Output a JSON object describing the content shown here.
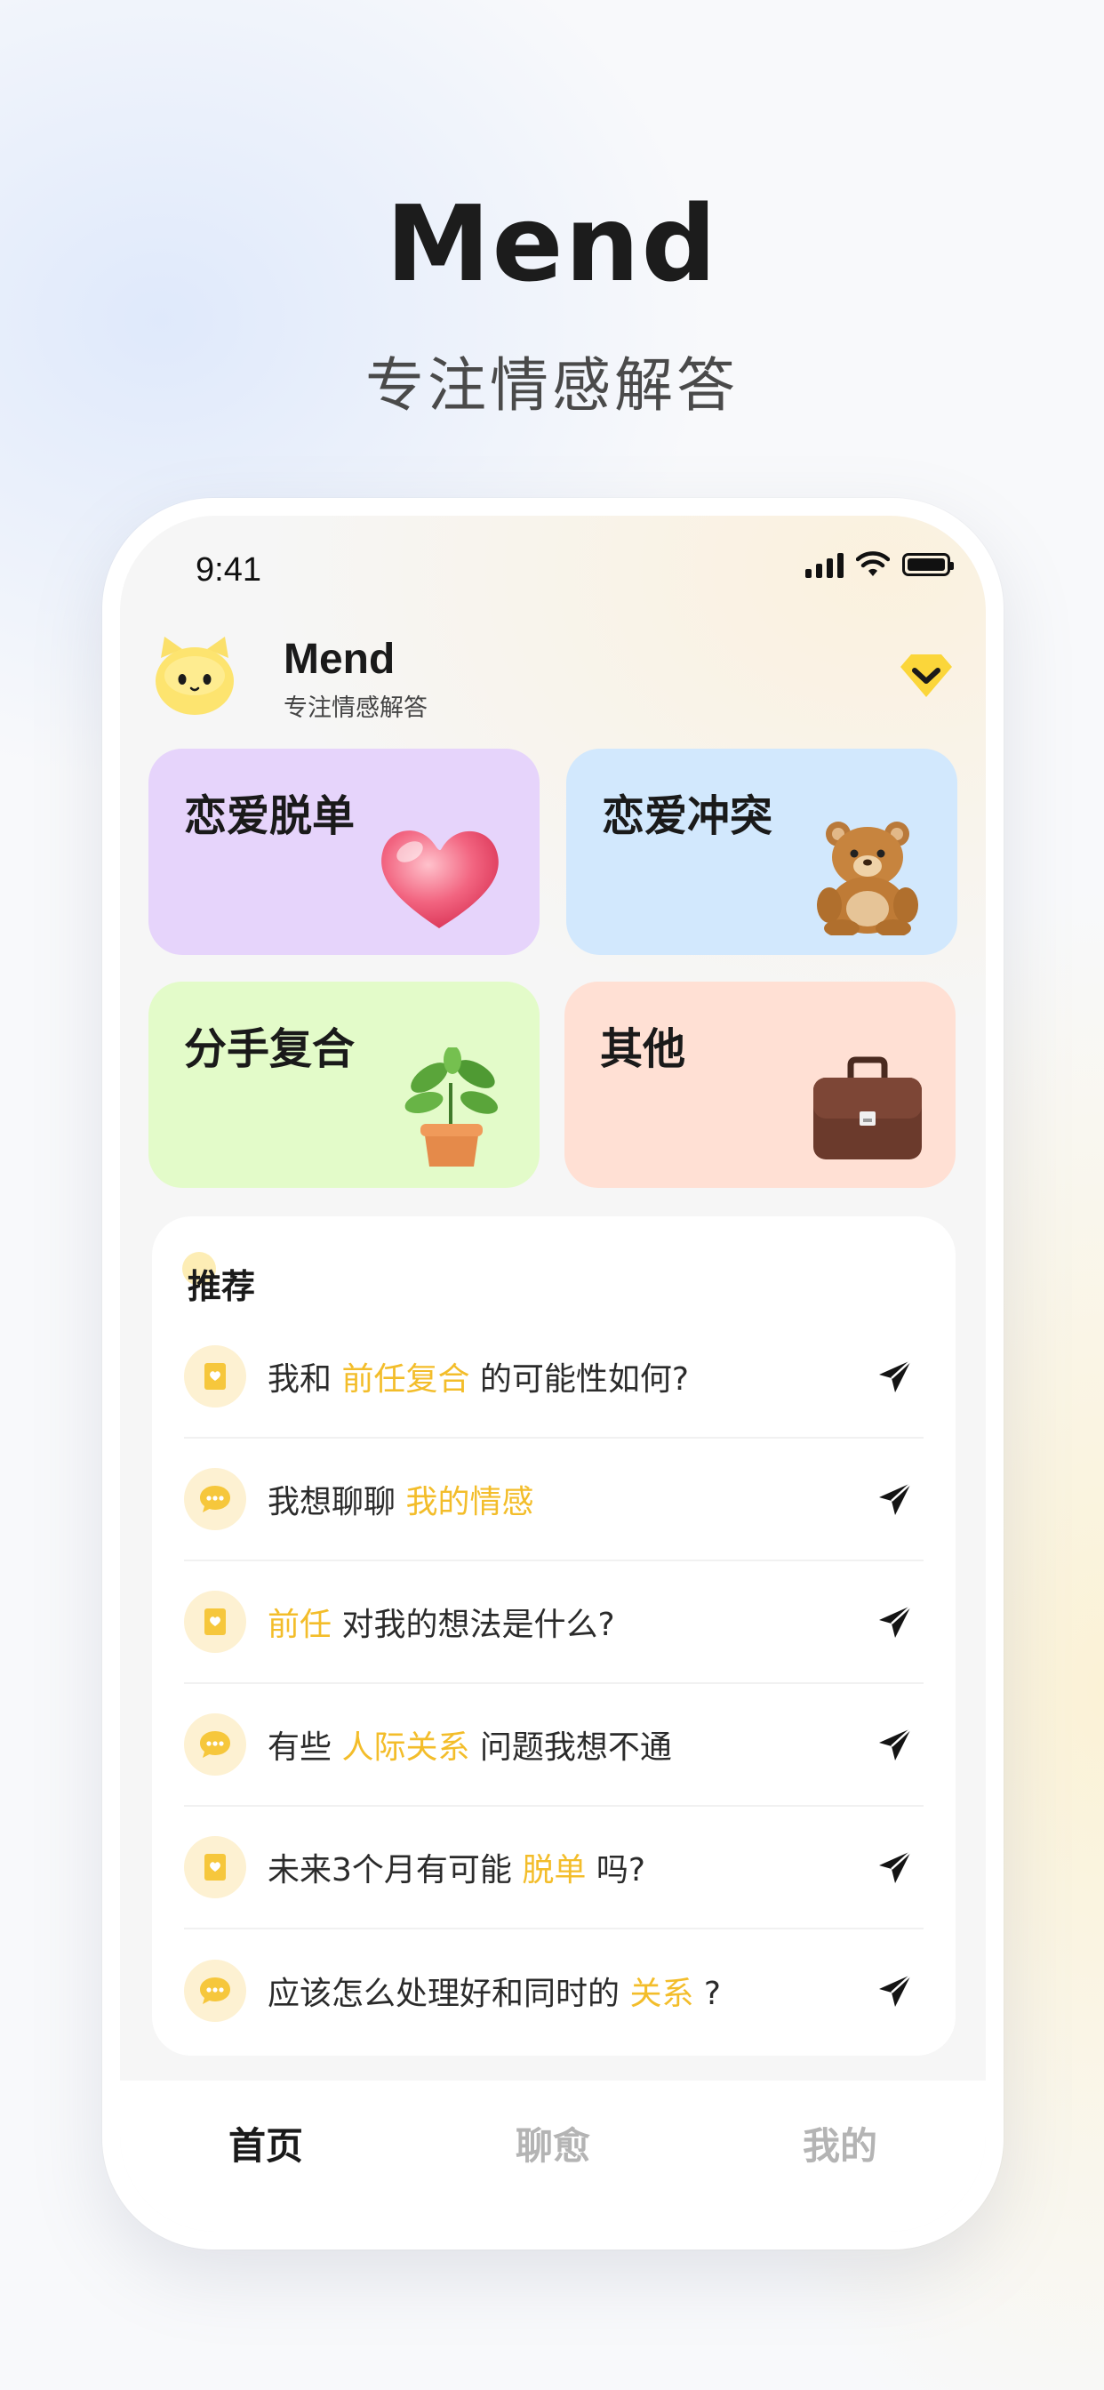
{
  "hero": {
    "title": "Mend",
    "subtitle": "专注情感解答"
  },
  "status_bar": {
    "time": "9:41"
  },
  "header": {
    "app_name": "Mend",
    "tagline": "专注情感解答",
    "avatar_icon": "yellow-cat-icon",
    "vip_icon": "diamond-chevron-icon"
  },
  "categories": [
    {
      "label": "恋爱脱单",
      "icon": "heart-icon",
      "color": "#e6d4fb"
    },
    {
      "label": "恋爱冲突",
      "icon": "teddy-bear-icon",
      "color": "#d2e8fd"
    },
    {
      "label": "分手复合",
      "icon": "potted-plant-icon",
      "color": "#e3fbc9"
    },
    {
      "label": "其他",
      "icon": "briefcase-icon",
      "color": "#ffe0d4"
    }
  ],
  "recommend": {
    "title": "推荐",
    "items": [
      {
        "icon": "book-heart-icon",
        "pre": "我和 ",
        "highlight": "前任复合",
        "post": " 的可能性如何?"
      },
      {
        "icon": "chat-bubble-icon",
        "pre": "我想聊聊 ",
        "highlight": "我的情感",
        "post": ""
      },
      {
        "icon": "book-heart-icon",
        "pre": "",
        "highlight": "前任",
        "post": " 对我的想法是什么?"
      },
      {
        "icon": "chat-bubble-icon",
        "pre": "有些 ",
        "highlight": "人际关系",
        "post": " 问题我想不通"
      },
      {
        "icon": "book-heart-icon",
        "pre": "未来3个月有可能 ",
        "highlight": "脱单",
        "post": " 吗?"
      },
      {
        "icon": "chat-bubble-icon",
        "pre": "应该怎么处理好和同时的 ",
        "highlight": "关系",
        "post": " ?"
      }
    ],
    "highlight_color": "#f3bd2a"
  },
  "tabbar": {
    "tabs": [
      {
        "label": "首页",
        "active": true
      },
      {
        "label": "聊愈",
        "active": false
      },
      {
        "label": "我的",
        "active": false
      }
    ]
  }
}
